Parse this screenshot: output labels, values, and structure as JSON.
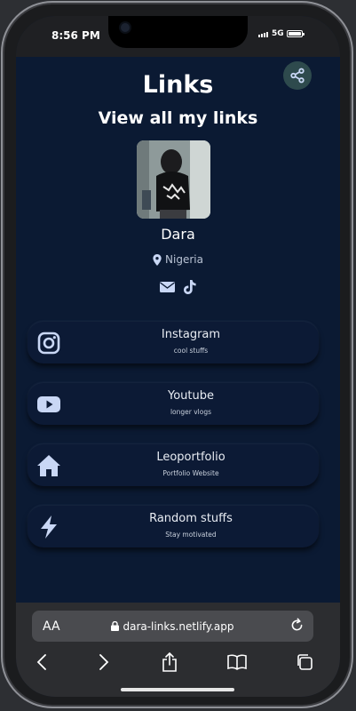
{
  "status_bar": {
    "time": "8:56 PM",
    "network": "5G"
  },
  "page": {
    "title": "Links",
    "subtitle": "View all my links"
  },
  "profile": {
    "name": "Dara",
    "location": "Nigeria"
  },
  "links": [
    {
      "title": "Instagram",
      "subtitle": "cool stuffs",
      "icon": "instagram-icon"
    },
    {
      "title": "Youtube",
      "subtitle": "longer vlogs",
      "icon": "youtube-icon"
    },
    {
      "title": "Leoportfolio",
      "subtitle": "Portfolio Website",
      "icon": "home-icon"
    },
    {
      "title": "Random stuffs",
      "subtitle": "Stay motivated",
      "icon": "bolt-icon"
    }
  ],
  "browser": {
    "aa_label": "AA",
    "url": "dara-links.netlify.app"
  },
  "colors": {
    "background": "#0b1a33",
    "icon": "#c9d7f5",
    "share_bg": "#2e4a4d"
  }
}
